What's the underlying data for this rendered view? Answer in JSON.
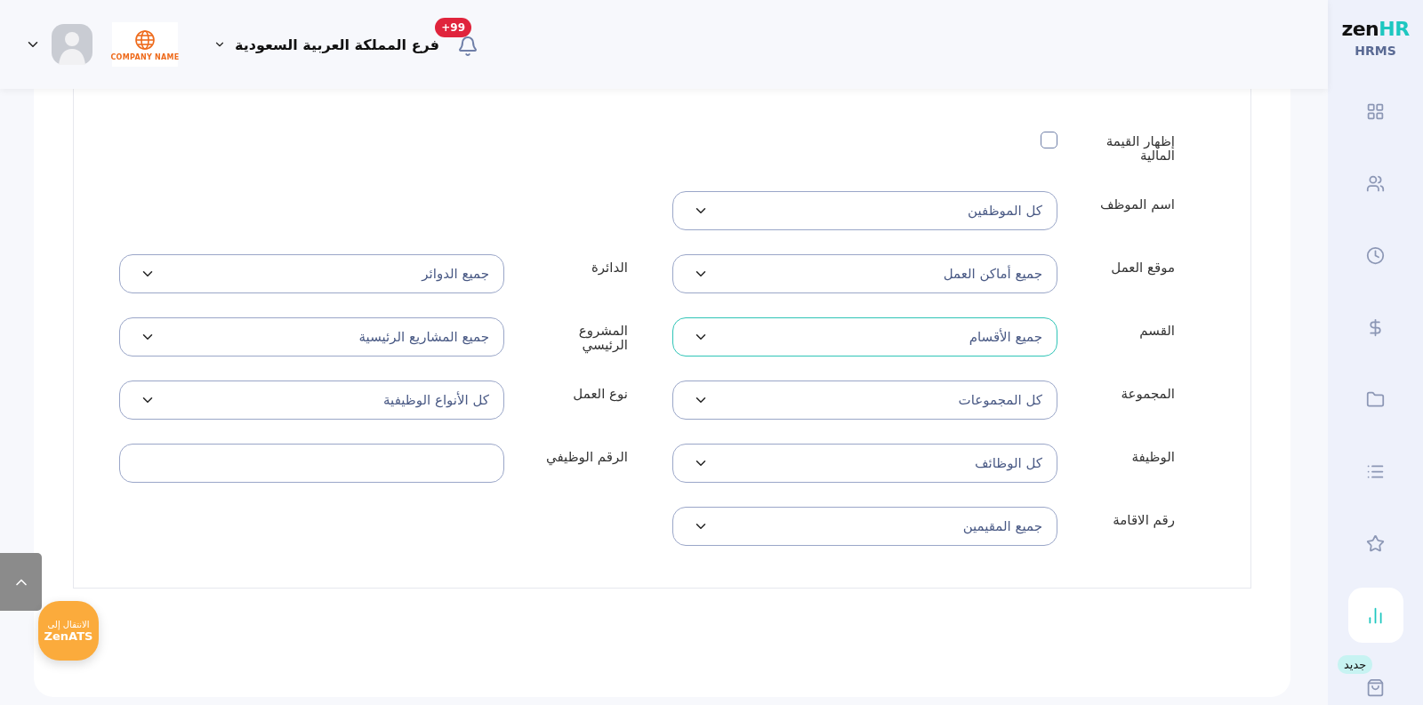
{
  "header": {
    "branch": "فرع المملكة العربية السعودية",
    "notification_count": "+99",
    "company_logo_text": "COMPANY NAME"
  },
  "sidebar": {
    "logo_main": "zen",
    "logo_accent": "HR",
    "product": "HRMS",
    "new_badge": "جديد",
    "items": [
      {
        "kind": "dashboard",
        "selected": false
      },
      {
        "kind": "people",
        "selected": false
      },
      {
        "kind": "clock",
        "selected": false
      },
      {
        "kind": "dollar",
        "selected": false
      },
      {
        "kind": "folder",
        "selected": false
      },
      {
        "kind": "list",
        "selected": false
      },
      {
        "kind": "star",
        "selected": false
      },
      {
        "kind": "chart",
        "selected": true
      },
      {
        "kind": "bag",
        "selected": false
      }
    ]
  },
  "form": {
    "rows": [
      [
        {
          "label": "إظهار القيمة المالية",
          "kind": "checkbox",
          "checked": false
        }
      ],
      [
        {
          "label": "اسم الموظف",
          "kind": "select",
          "value": "كل الموظفين",
          "focused": false
        }
      ],
      [
        {
          "label": "موقع العمل",
          "kind": "select",
          "value": "جميع أماكن العمل",
          "focused": false
        },
        {
          "label": "الدائرة",
          "kind": "select",
          "value": "جميع الدوائر",
          "focused": false
        }
      ],
      [
        {
          "label": "القسم",
          "kind": "select",
          "value": "جميع الأقسام",
          "focused": true
        },
        {
          "label": "المشروع الرئيسي",
          "kind": "select",
          "value": "جميع المشاريع الرئيسية",
          "focused": false
        }
      ],
      [
        {
          "label": "المجموعة",
          "kind": "select",
          "value": "كل المجموعات",
          "focused": false
        },
        {
          "label": "نوع العمل",
          "kind": "select",
          "value": "كل الأنواع الوظيفية",
          "focused": false
        }
      ],
      [
        {
          "label": "الوظيفة",
          "kind": "select",
          "value": "كل الوظائف",
          "focused": false
        },
        {
          "label": "الرقم الوظيفي",
          "kind": "input",
          "focused": false
        }
      ],
      [
        {
          "label": "رقم الاقامة",
          "kind": "select",
          "value": "جميع المقيمين",
          "focused": false
        }
      ]
    ]
  },
  "ats_button": {
    "line1": "الانتقال إلى",
    "line2": "ZenATS"
  }
}
